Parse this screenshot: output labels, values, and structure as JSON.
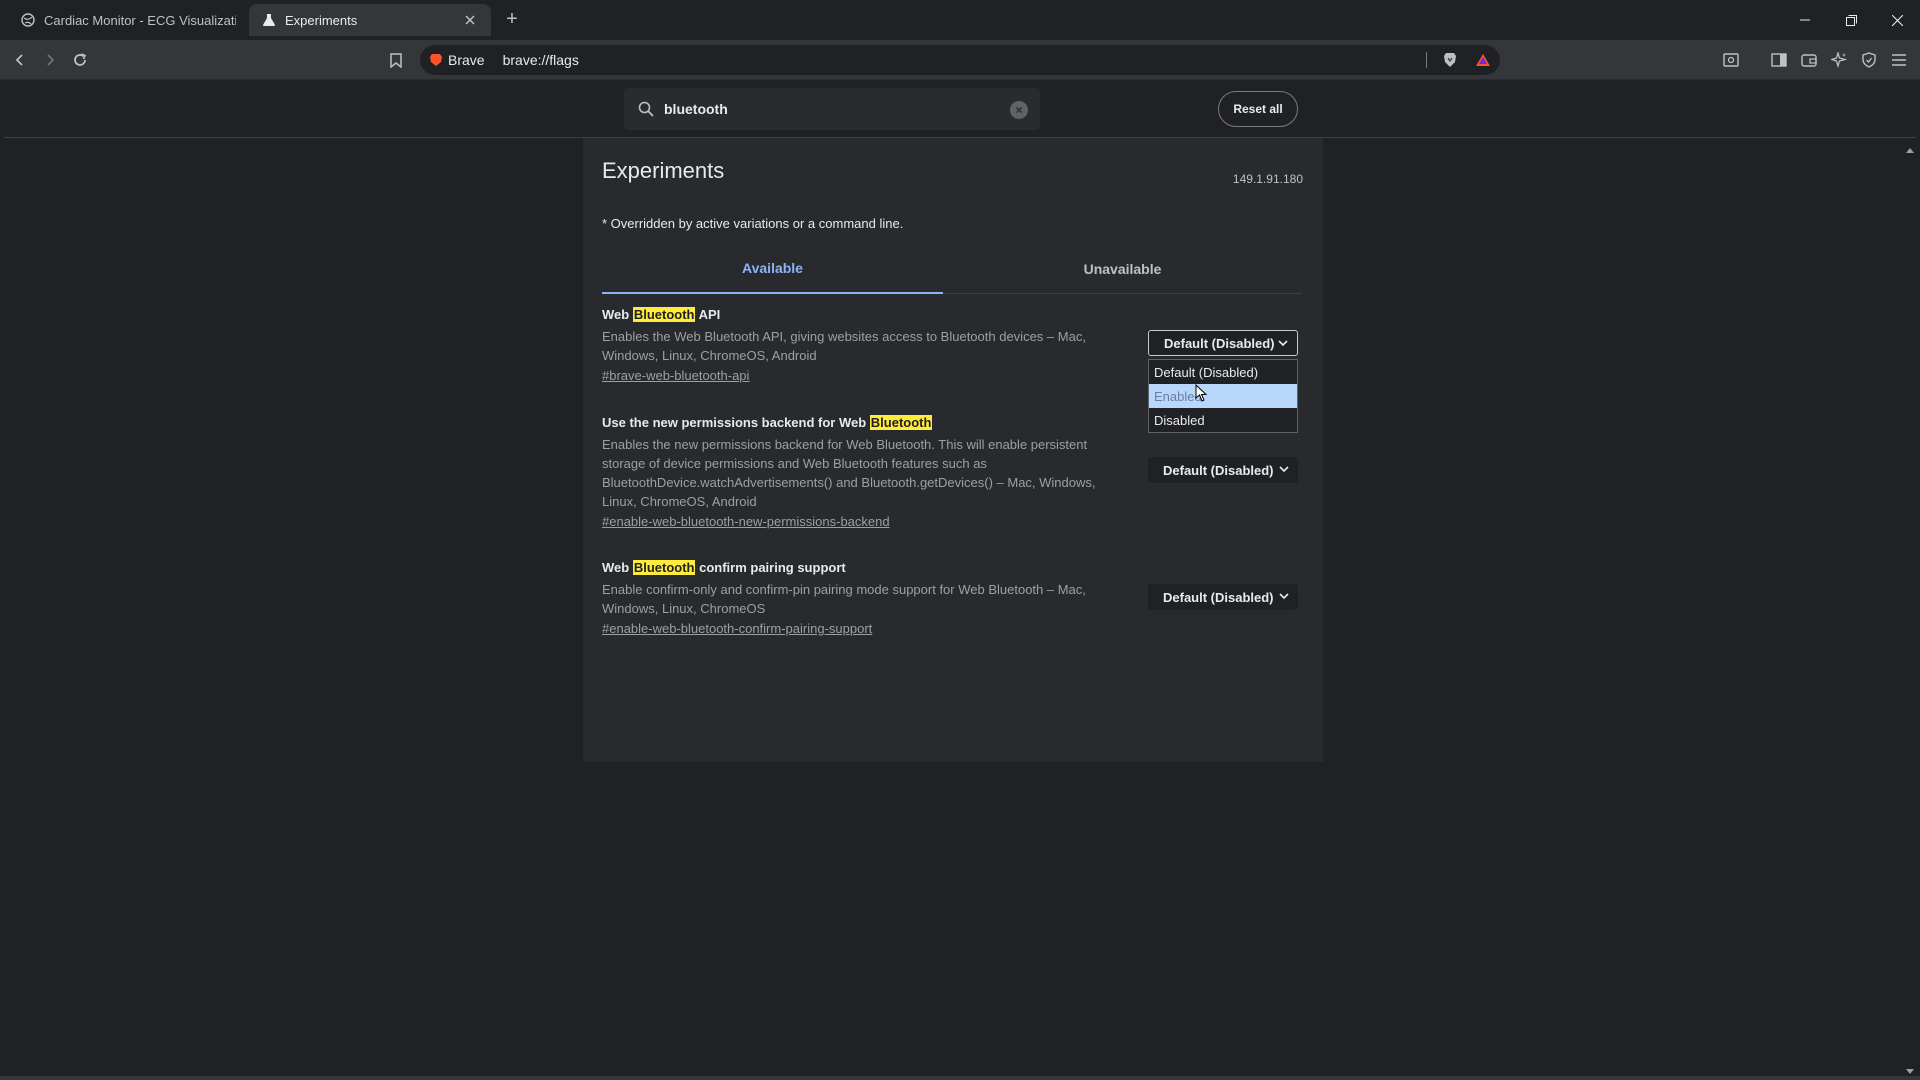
{
  "browser": {
    "tabs": [
      {
        "label": "Cardiac Monitor - ECG Visualization",
        "active": false
      },
      {
        "label": "Experiments",
        "active": true
      }
    ],
    "omnibox": {
      "brand": "Brave",
      "url": "brave://flags"
    }
  },
  "flags_header": {
    "search_value": "bluetooth",
    "reset_label": "Reset all"
  },
  "page": {
    "title": "Experiments",
    "version": "149.1.91.180",
    "override_note": "* Overridden by active variations or a command line.",
    "tabs": [
      {
        "label": "Available",
        "active": true
      },
      {
        "label": "Unavailable",
        "active": false
      }
    ]
  },
  "flags": [
    {
      "name_before": "Web ",
      "name_highlight": "Bluetooth",
      "name_after": " API",
      "description": "Enables the Web Bluetooth API, giving websites access to Bluetooth devices – Mac, Windows, Linux, ChromeOS, Android",
      "link": "#brave-web-bluetooth-api",
      "value": "Default (Disabled)"
    },
    {
      "name_before": "Use the new permissions backend for Web ",
      "name_highlight": "Bluetooth",
      "name_after": "",
      "description": "Enables the new permissions backend for Web Bluetooth. This will enable persistent storage of device permissions and Web Bluetooth features such as BluetoothDevice.watchAdvertisements() and Bluetooth.getDevices() – Mac, Windows, Linux, ChromeOS, Android",
      "link": "#enable-web-bluetooth-new-permissions-backend",
      "value": "Default (Disabled)"
    },
    {
      "name_before": "Web ",
      "name_highlight": "Bluetooth",
      "name_after": " confirm pairing support",
      "description": "Enable confirm-only and confirm-pin pairing mode support for Web Bluetooth – Mac, Windows, Linux, ChromeOS",
      "link": "#enable-web-bluetooth-confirm-pairing-support",
      "value": "Default (Disabled)"
    }
  ],
  "dropdown": {
    "options": [
      "Default (Disabled)",
      "Enabled",
      "Disabled"
    ],
    "hovered": "Enabled"
  },
  "colors": {
    "accent": "#8ab4f8",
    "highlight": "#ffeb3b",
    "background": "#202124",
    "panel": "#292a2d"
  }
}
